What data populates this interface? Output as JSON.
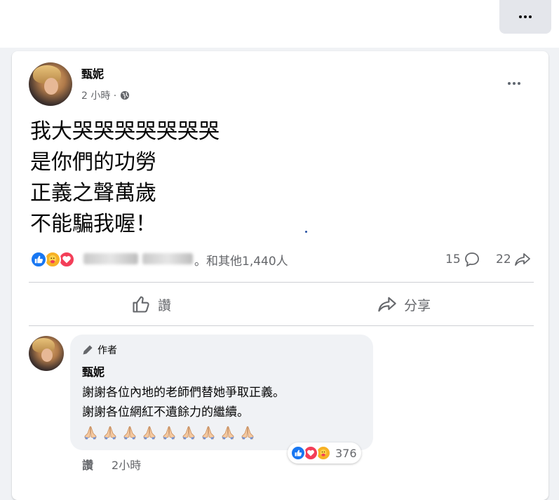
{
  "post": {
    "author": "甄妮",
    "time": "2 小時 ·",
    "body_lines": [
      "我大哭哭哭哭哭哭哭",
      "是你們的功勞",
      "正義之聲萬歲",
      "不能騙我喔！"
    ],
    "reactions_suffix": "。和其他1,440人",
    "comment_count": "15",
    "share_count": "22",
    "like_label": "讚",
    "share_label": "分享"
  },
  "comment": {
    "badge": "作者",
    "author": "甄妮",
    "lines": [
      "謝謝各位內地的老師們替她爭取正義。",
      "謝謝各位網紅不遺餘力的繼續。"
    ],
    "emoji": "🙏",
    "emoji_count": 9,
    "reaction_count": "376",
    "like_label": "讚",
    "time": "2小時"
  },
  "colors": {
    "like": "#1877f2",
    "love": "#f33e58",
    "care": "#f7b125",
    "muted": "#65676b"
  },
  "icons": [
    "more-dots-icon",
    "globe-icon",
    "like-reaction-icon",
    "care-reaction-icon",
    "love-reaction-icon",
    "comment-icon",
    "share-arrow-icon",
    "thumbs-up-icon",
    "pencil-icon",
    "praying-hands-icon"
  ]
}
